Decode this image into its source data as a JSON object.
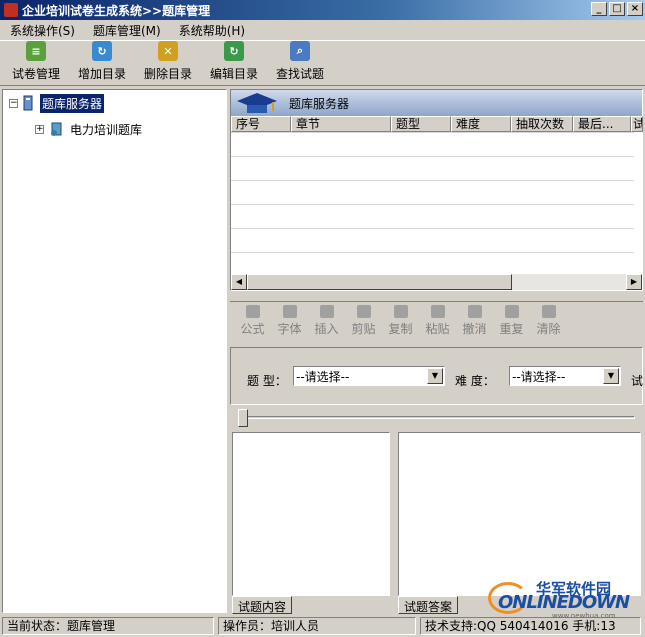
{
  "window": {
    "title": "企业培训试卷生成系统>>题库管理",
    "buttons": {
      "minimize": "_",
      "maximize": "□",
      "close": "×"
    }
  },
  "menu": [
    "系统操作(S)",
    "题库管理(M)",
    "系统帮助(H)"
  ],
  "toolbar": [
    {
      "label": "试卷管理",
      "icon": "exam-paper-icon",
      "color": "#5aa03c"
    },
    {
      "label": "增加目录",
      "icon": "add-folder-icon",
      "color": "#3a8ad0"
    },
    {
      "label": "删除目录",
      "icon": "delete-folder-icon",
      "color": "#d0a020"
    },
    {
      "label": "编辑目录",
      "icon": "edit-folder-icon",
      "color": "#3a9a4a"
    },
    {
      "label": "查找试题",
      "icon": "search-icon",
      "color": "#4a7ac0"
    }
  ],
  "tree": {
    "root": "题库服务器",
    "children": [
      "电力培训题库"
    ]
  },
  "grid": {
    "title": "题库服务器",
    "columns": [
      "序号",
      "章节",
      "题型",
      "难度",
      "抽取次数",
      "最后...",
      "试"
    ]
  },
  "edit_toolbar": [
    "公式",
    "字体",
    "插入",
    "剪贴",
    "复制",
    "粘贴",
    "撤消",
    "重复",
    "清除"
  ],
  "filter": {
    "type_label": "题  型：",
    "type_value": "--请选择--",
    "difficulty_label": "难  度：",
    "difficulty_value": "--请选择--",
    "extra_label": "试"
  },
  "panes": {
    "content_tab": "试题内容",
    "answer_tab": "试题答案"
  },
  "status": {
    "state": "当前状态：题库管理",
    "operator": "操作员：培训人员",
    "support": "技术支持:QQ 540414016 手机:13"
  },
  "watermark": {
    "cn": "华军软件园",
    "en": "ONLINEDOWN",
    "url": "www.newhua.com"
  }
}
